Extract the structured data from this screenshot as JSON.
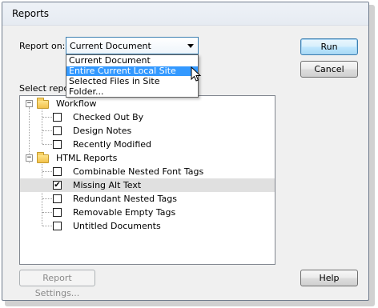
{
  "window": {
    "title": "Reports"
  },
  "report_on": {
    "label": "Report on:",
    "selected": "Current Document",
    "options": [
      "Current Document",
      "Entire Current Local Site",
      "Selected Files in Site",
      "Folder..."
    ],
    "highlighted_option": "Entire Current Local Site"
  },
  "select_reports_label": "Select repor",
  "tree": {
    "groups": [
      {
        "name": "Workflow",
        "expander": "−",
        "items": [
          {
            "label": "Checked Out By",
            "checked": false
          },
          {
            "label": "Design Notes",
            "checked": false
          },
          {
            "label": "Recently Modified",
            "checked": false
          }
        ]
      },
      {
        "name": "HTML Reports",
        "expander": "−",
        "items": [
          {
            "label": "Combinable Nested Font Tags",
            "checked": false
          },
          {
            "label": "Missing Alt Text",
            "checked": true,
            "check_mark": "✔"
          },
          {
            "label": "Redundant Nested Tags",
            "checked": false
          },
          {
            "label": "Removable Empty Tags",
            "checked": false
          },
          {
            "label": "Untitled Documents",
            "checked": false
          }
        ]
      }
    ]
  },
  "buttons": {
    "run": "Run",
    "cancel": "Cancel",
    "help": "Help",
    "report_settings": "Report Settings..."
  },
  "colors": {
    "selection": "#3399ff",
    "default_button_border": "#3c7fb1",
    "row_highlight": "#e0e0e0"
  }
}
